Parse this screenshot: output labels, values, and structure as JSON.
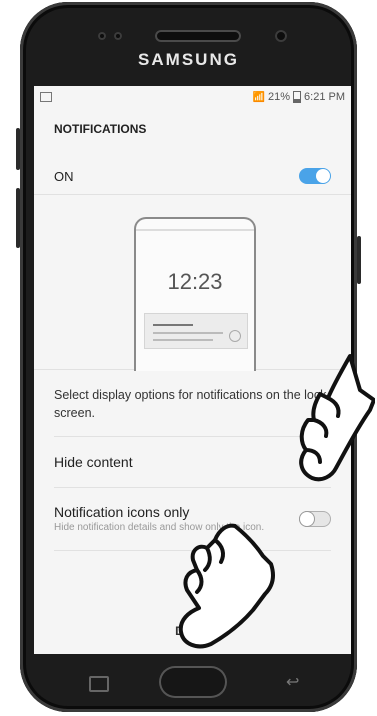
{
  "device": {
    "brand": "SAMSUNG"
  },
  "status_bar": {
    "battery": "21%",
    "time": "6:21 PM",
    "icons": [
      "image-icon",
      "wifi-icon",
      "signal-icon",
      "battery-icon"
    ]
  },
  "screen": {
    "header": "NOTIFICATIONS",
    "master_toggle": {
      "label": "ON",
      "state": "on"
    },
    "illustration": {
      "time": "12:23"
    },
    "description": "Select display options for notifications on the lock screen.",
    "options": [
      {
        "title": "Hide content",
        "subtitle": "",
        "state": "off"
      },
      {
        "title": "Notification icons only",
        "subtitle": "Hide notification details and show only the icon.",
        "state": "off"
      }
    ],
    "done_label": "DONE"
  },
  "colors": {
    "toggle_on": "#4aa3e8",
    "toggle_off": "#e6e6e6",
    "screen_bg": "#f5f5f5"
  }
}
